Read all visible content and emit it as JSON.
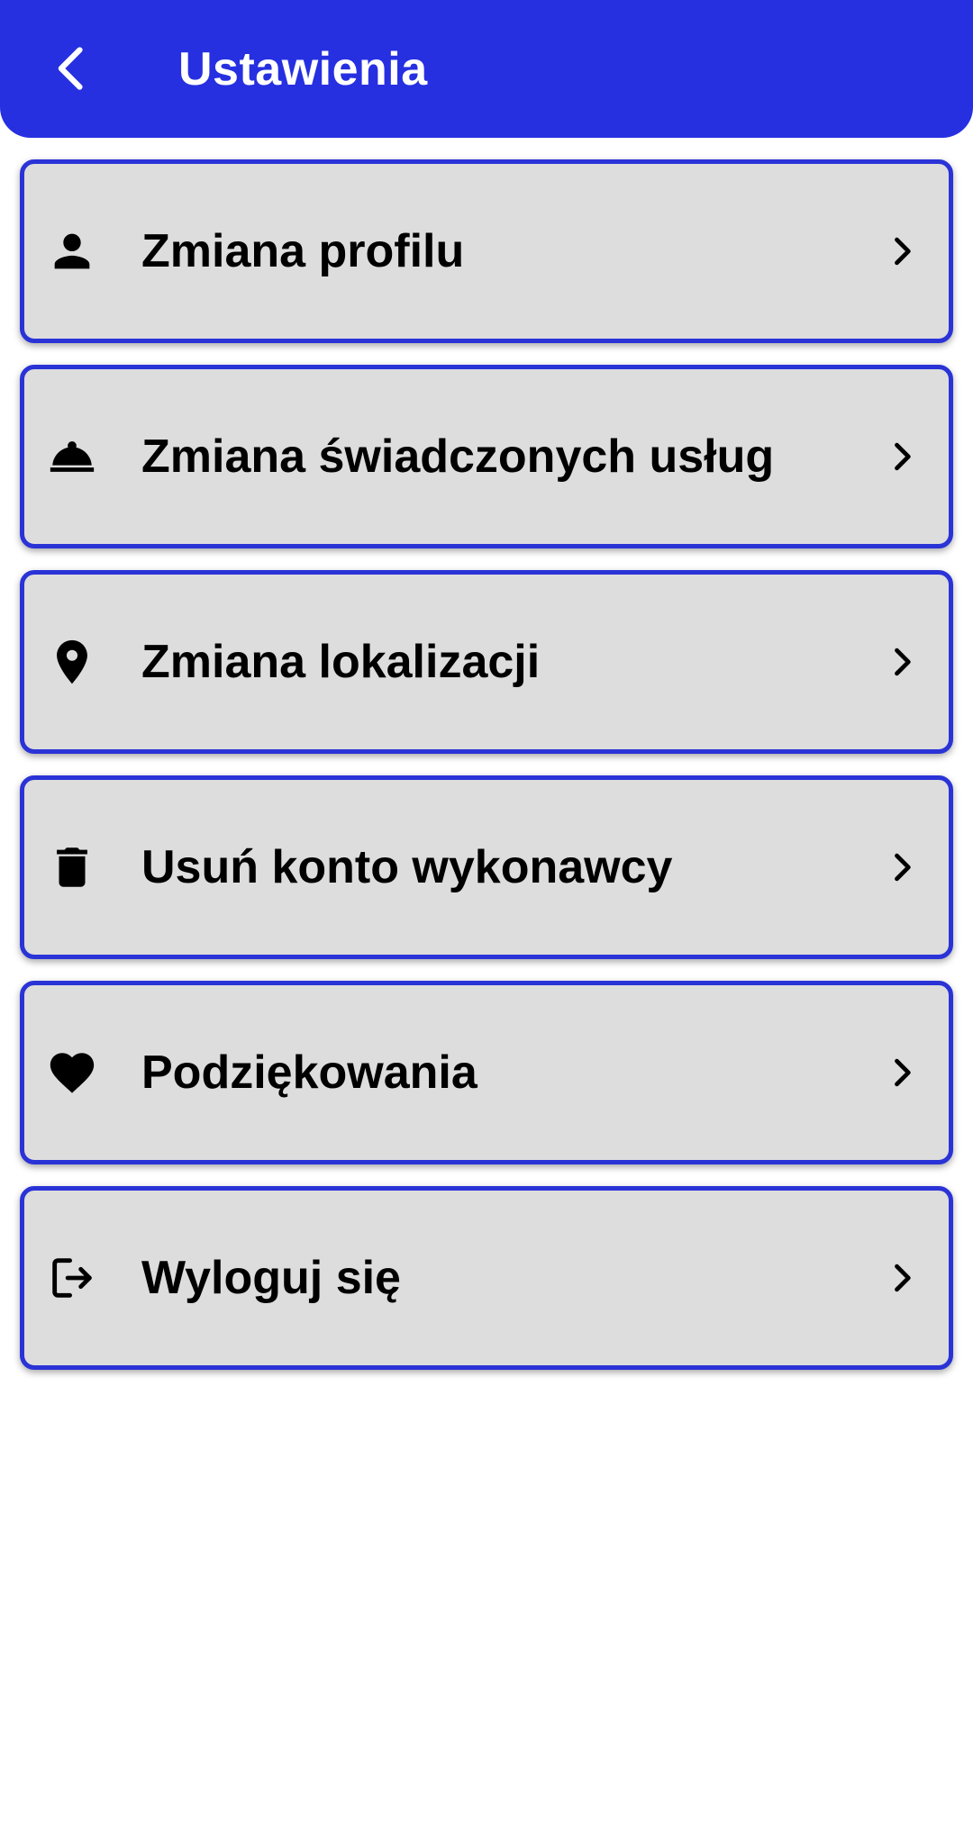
{
  "header": {
    "title": "Ustawienia",
    "back_icon": "arrow-back-icon",
    "background_color": "#2630e0"
  },
  "menu": {
    "items": [
      {
        "label": "Zmiana profilu",
        "icon": "person-icon"
      },
      {
        "label": "Zmiana świadczonych usług",
        "icon": "room-service-icon"
      },
      {
        "label": "Zmiana lokalizacji",
        "icon": "location-pin-icon"
      },
      {
        "label": "Usuń konto wykonawcy",
        "icon": "trash-icon"
      },
      {
        "label": "Podziękowania",
        "icon": "heart-icon"
      },
      {
        "label": "Wyloguj się",
        "icon": "logout-icon"
      }
    ],
    "item_background": "#dddddd",
    "item_border_color": "#2a33d6",
    "chevron_icon": "chevron-right-icon"
  }
}
